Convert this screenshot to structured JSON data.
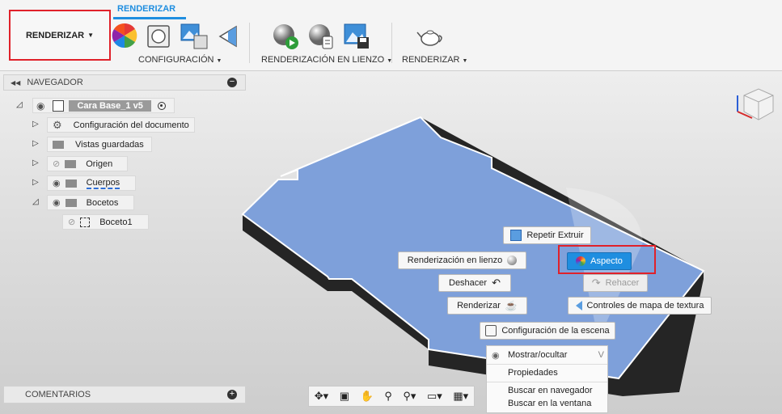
{
  "toolbar": {
    "workspace_label": "RENDERIZAR",
    "tab_label": "RENDERIZAR",
    "groups": {
      "setup_label": "CONFIGURACIÓN",
      "incanvas_label": "RENDERIZACIÓN EN LIENZO",
      "render_label": "RENDERIZAR"
    }
  },
  "browser": {
    "title": "NAVEGADOR",
    "root_label": "Cara Base_1 v5",
    "items": [
      {
        "label": "Configuración del documento"
      },
      {
        "label": "Vistas guardadas"
      },
      {
        "label": "Origen"
      },
      {
        "label": "Cuerpos"
      },
      {
        "label": "Bocetos"
      },
      {
        "label": "Boceto1"
      }
    ]
  },
  "comments": {
    "label": "COMENTARIOS"
  },
  "marking_menu": {
    "repeat_label": "Repetir Extruir",
    "incanvas_label": "Renderización en lienzo",
    "appearance_label": "Aspecto",
    "undo_label": "Deshacer",
    "redo_label": "Rehacer",
    "render_label": "Renderizar",
    "texture_label": "Controles de mapa de textura",
    "scene_label": "Configuración de la escena"
  },
  "context_menu": {
    "show_hide_label": "Mostrar/ocultar",
    "show_hide_shortcut": "V",
    "properties_label": "Propiedades",
    "find_browser_label": "Buscar en navegador",
    "find_window_label": "Buscar en la ventana"
  },
  "colors": {
    "accent": "#1f8ee0",
    "highlight": "#e0212a",
    "body_blue": "#7ea0da"
  }
}
